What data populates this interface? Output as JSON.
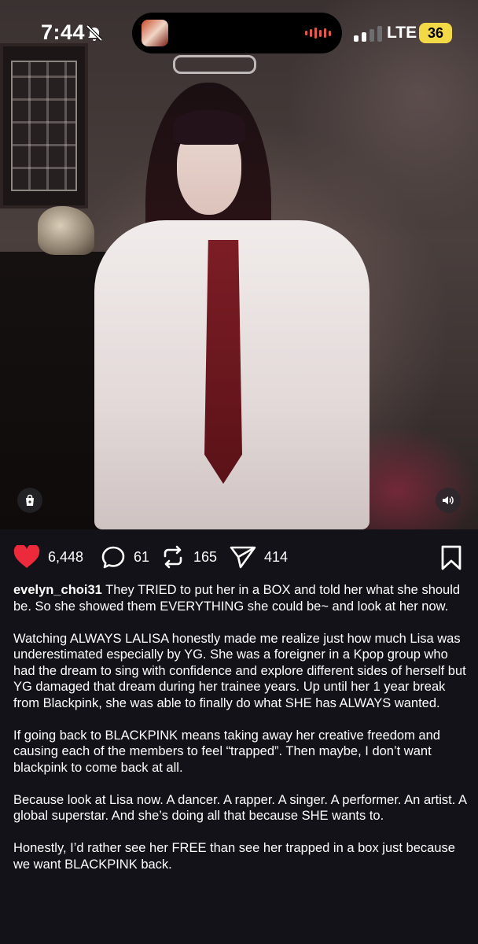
{
  "status_bar": {
    "time": "7:44",
    "network": "LTE",
    "battery": "36",
    "battery_color": "#f4d946"
  },
  "media": {
    "shopping_icon": "shopping-bag-icon",
    "sound_icon": "speaker-icon"
  },
  "actions": {
    "likes": "6,448",
    "comments": "61",
    "reposts": "165",
    "shares": "414",
    "like_color": "#ed2a3c"
  },
  "caption": {
    "username": "evelyn_choi31",
    "first_text": " They TRIED to put her in a BOX and told her what she should be. So she showed them EVERYTHING she could be~ and look at her now.",
    "paragraphs": [
      "Watching ALWAYS LALISA honestly made me realize just how much Lisa was underestimated especially by YG. She was a foreigner in a Kpop group who had the dream to sing with confidence and explore different sides of herself but YG damaged that dream during her trainee years. Up until her 1 year break from Blackpink, she was able to finally do what SHE has ALWAYS wanted.",
      "If going back to BLACKPINK means taking away her creative freedom and causing each of the members to feel “trapped”. Then maybe, I don’t want blackpink to come back at all.",
      "Because look at Lisa now. A dancer. A rapper. A singer. A performer. An artist. A global superstar. And she’s doing all that because SHE wants to.",
      "Honestly, I’d rather see her FREE than see her trapped in a box just because we want BLACKPINK back."
    ]
  }
}
